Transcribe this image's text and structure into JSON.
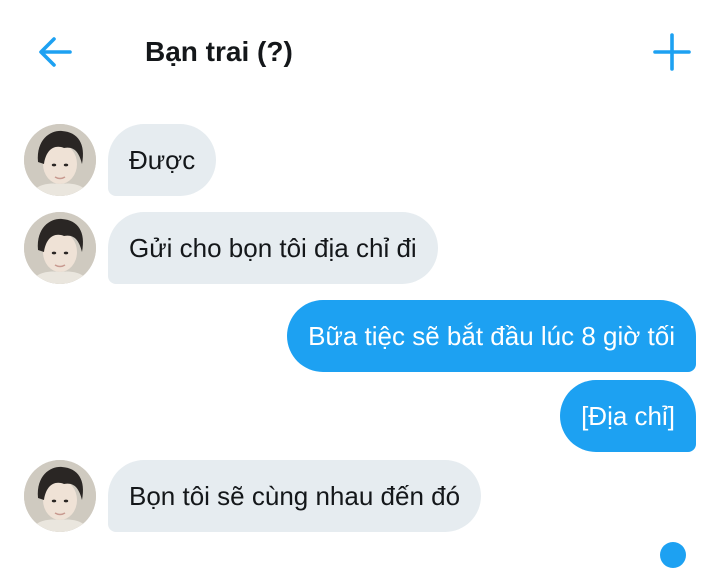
{
  "header": {
    "back_icon": "arrow-left-icon",
    "title": "Bạn trai (?)",
    "add_icon": "plus-icon",
    "accent_color": "#1da1f2"
  },
  "messages": [
    {
      "direction": "incoming",
      "text": "Được"
    },
    {
      "direction": "incoming",
      "text": "Gửi cho bọn tôi địa chỉ đi"
    },
    {
      "direction": "outgoing",
      "text": "Bữa tiệc sẽ bắt đầu lúc 8 giờ tối"
    },
    {
      "direction": "outgoing",
      "text": "[Địa chỉ]"
    },
    {
      "direction": "incoming",
      "text": "Bọn tôi sẽ cùng nhau đến đó"
    }
  ],
  "colors": {
    "incoming_bubble": "#e6ecf0",
    "outgoing_bubble": "#1da1f2",
    "text_dark": "#14171a"
  }
}
